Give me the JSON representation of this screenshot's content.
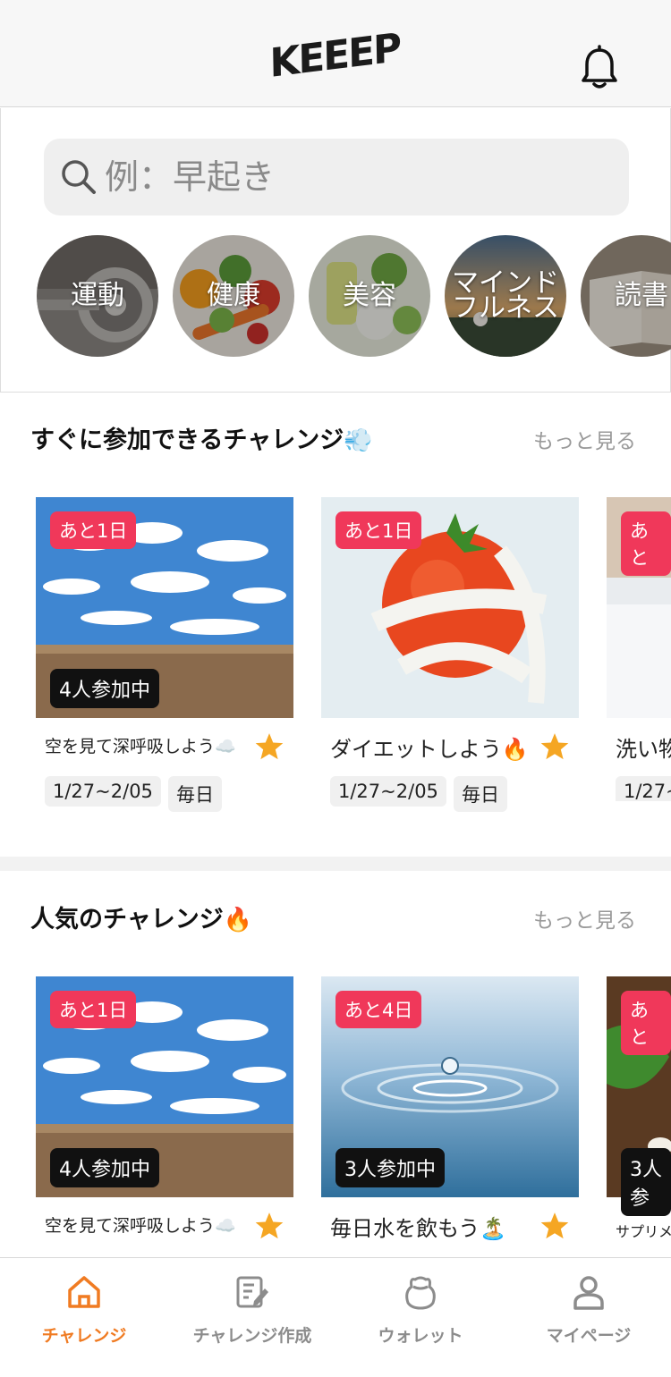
{
  "header": {
    "logo": "KEEEP",
    "bell_icon": "bell-icon"
  },
  "search": {
    "placeholder": "例：早起き",
    "icon": "search-icon"
  },
  "categories": [
    {
      "label": "運動"
    },
    {
      "label": "健康"
    },
    {
      "label": "美容"
    },
    {
      "label": "マインドフルネス"
    },
    {
      "label": "読書"
    }
  ],
  "sections": [
    {
      "title": "すぐに参加できるチャレンジ",
      "emoji": "💨",
      "more": "もっと見る",
      "cards": [
        {
          "days_left": "あと1日",
          "participants": "4人参加中",
          "name": "空を見て深呼吸しよう",
          "emoji": "☁️",
          "period": "1/27~2/05",
          "frequency": "毎日"
        },
        {
          "days_left": "あと1日",
          "participants": "",
          "name": "ダイエットしよう",
          "emoji": "🔥",
          "period": "1/27~2/05",
          "frequency": "毎日"
        },
        {
          "days_left": "あと",
          "participants": "",
          "name": "洗い物",
          "emoji": "",
          "period": "1/27~",
          "frequency": ""
        }
      ]
    },
    {
      "title": "人気のチャレンジ",
      "emoji": "🔥",
      "more": "もっと見る",
      "cards": [
        {
          "days_left": "あと1日",
          "participants": "4人参加中",
          "name": "空を見て深呼吸しよう",
          "emoji": "☁️"
        },
        {
          "days_left": "あと4日",
          "participants": "3人参加中",
          "name": "毎日水を飲もう",
          "emoji": "🏝️"
        },
        {
          "days_left": "あと",
          "participants": "3人参",
          "name": "サプリメ",
          "emoji": ""
        }
      ]
    }
  ],
  "nav": [
    {
      "label": "チャレンジ",
      "icon": "home-icon",
      "active": true
    },
    {
      "label": "チャレンジ作成",
      "icon": "edit-note-icon",
      "active": false
    },
    {
      "label": "ウォレット",
      "icon": "wallet-pouch-icon",
      "active": false
    },
    {
      "label": "マイページ",
      "icon": "user-icon",
      "active": false
    }
  ],
  "colors": {
    "accent": "#f07b22",
    "badge": "#f0385a",
    "star": "#f5a623"
  }
}
